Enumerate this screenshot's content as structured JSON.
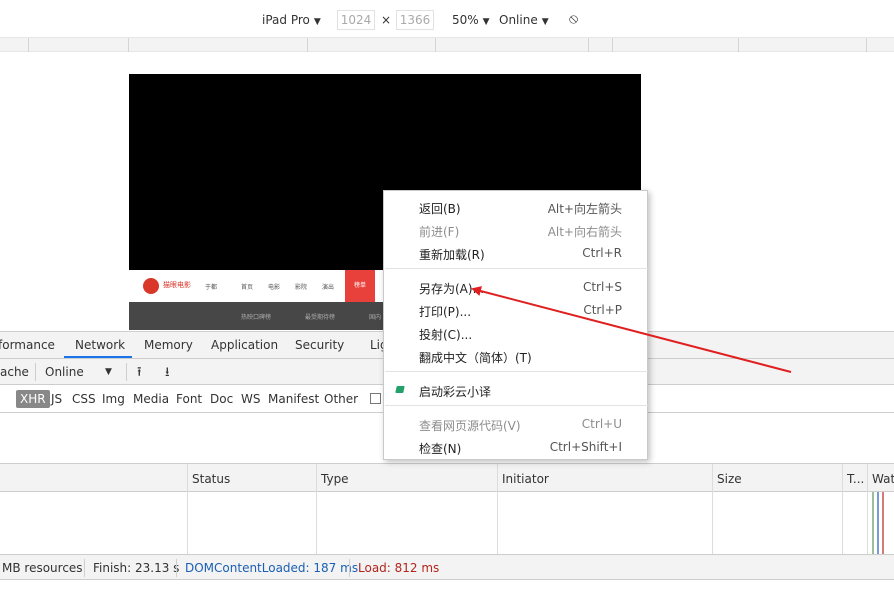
{
  "device_toolbar": {
    "device": "iPad Pro",
    "width": "1024",
    "times": "×",
    "height": "1366",
    "zoom": "50%",
    "throttle": "Online"
  },
  "site": {
    "name": "猫眼电影",
    "city": "于都",
    "nav": [
      "首页",
      "电影",
      "影院",
      "演出"
    ],
    "nav_active": "榜单",
    "subnav": [
      "热映口碑榜",
      "最受期待榜",
      "国内"
    ]
  },
  "devtools": {
    "tabs": [
      "formance",
      "Network",
      "Memory",
      "Application",
      "Security",
      "Lig"
    ],
    "active_tab": "Network",
    "toolbar": {
      "cache_label": "ache",
      "throttle": "Online"
    },
    "filters": [
      "XHR",
      "JS",
      "CSS",
      "Img",
      "Media",
      "Font",
      "Doc",
      "WS",
      "Manifest",
      "Other"
    ],
    "selected_filter": "XHR",
    "columns": [
      "Status",
      "Type",
      "Initiator",
      "Size",
      "T...",
      "Wat"
    ],
    "status": {
      "resources": "MB resources",
      "finish": "Finish: 23.13 s",
      "dom_loaded": "DOMContentLoaded: 187 ms",
      "load": "Load: 812 ms"
    },
    "colors": {
      "dom_loaded": "#1a5fb4",
      "load": "#b3261e",
      "tab_underline": "#1a73e8"
    }
  },
  "context_menu": {
    "groups": [
      [
        {
          "label": "返回(B)",
          "shortcut": "Alt+向左箭头",
          "disabled": false
        },
        {
          "label": "前进(F)",
          "shortcut": "Alt+向右箭头",
          "disabled": true
        },
        {
          "label": "重新加载(R)",
          "shortcut": "Ctrl+R",
          "disabled": false
        }
      ],
      [
        {
          "label": "另存为(A)...",
          "shortcut": "Ctrl+S",
          "disabled": false
        },
        {
          "label": "打印(P)...",
          "shortcut": "Ctrl+P",
          "disabled": false
        },
        {
          "label": "投射(C)...",
          "shortcut": "",
          "disabled": false
        },
        {
          "label": "翻成中文（简体）(T)",
          "shortcut": "",
          "disabled": false
        }
      ],
      [
        {
          "label": "启动彩云小译",
          "shortcut": "",
          "disabled": false,
          "icon": "caiyun-icon"
        }
      ],
      [
        {
          "label": "查看网页源代码(V)",
          "shortcut": "Ctrl+U",
          "disabled": true
        },
        {
          "label": "检查(N)",
          "shortcut": "Ctrl+Shift+I",
          "disabled": false
        }
      ]
    ]
  },
  "annotation": {
    "arrow_color": "#e02020",
    "points_to": "另存为(A)..."
  }
}
